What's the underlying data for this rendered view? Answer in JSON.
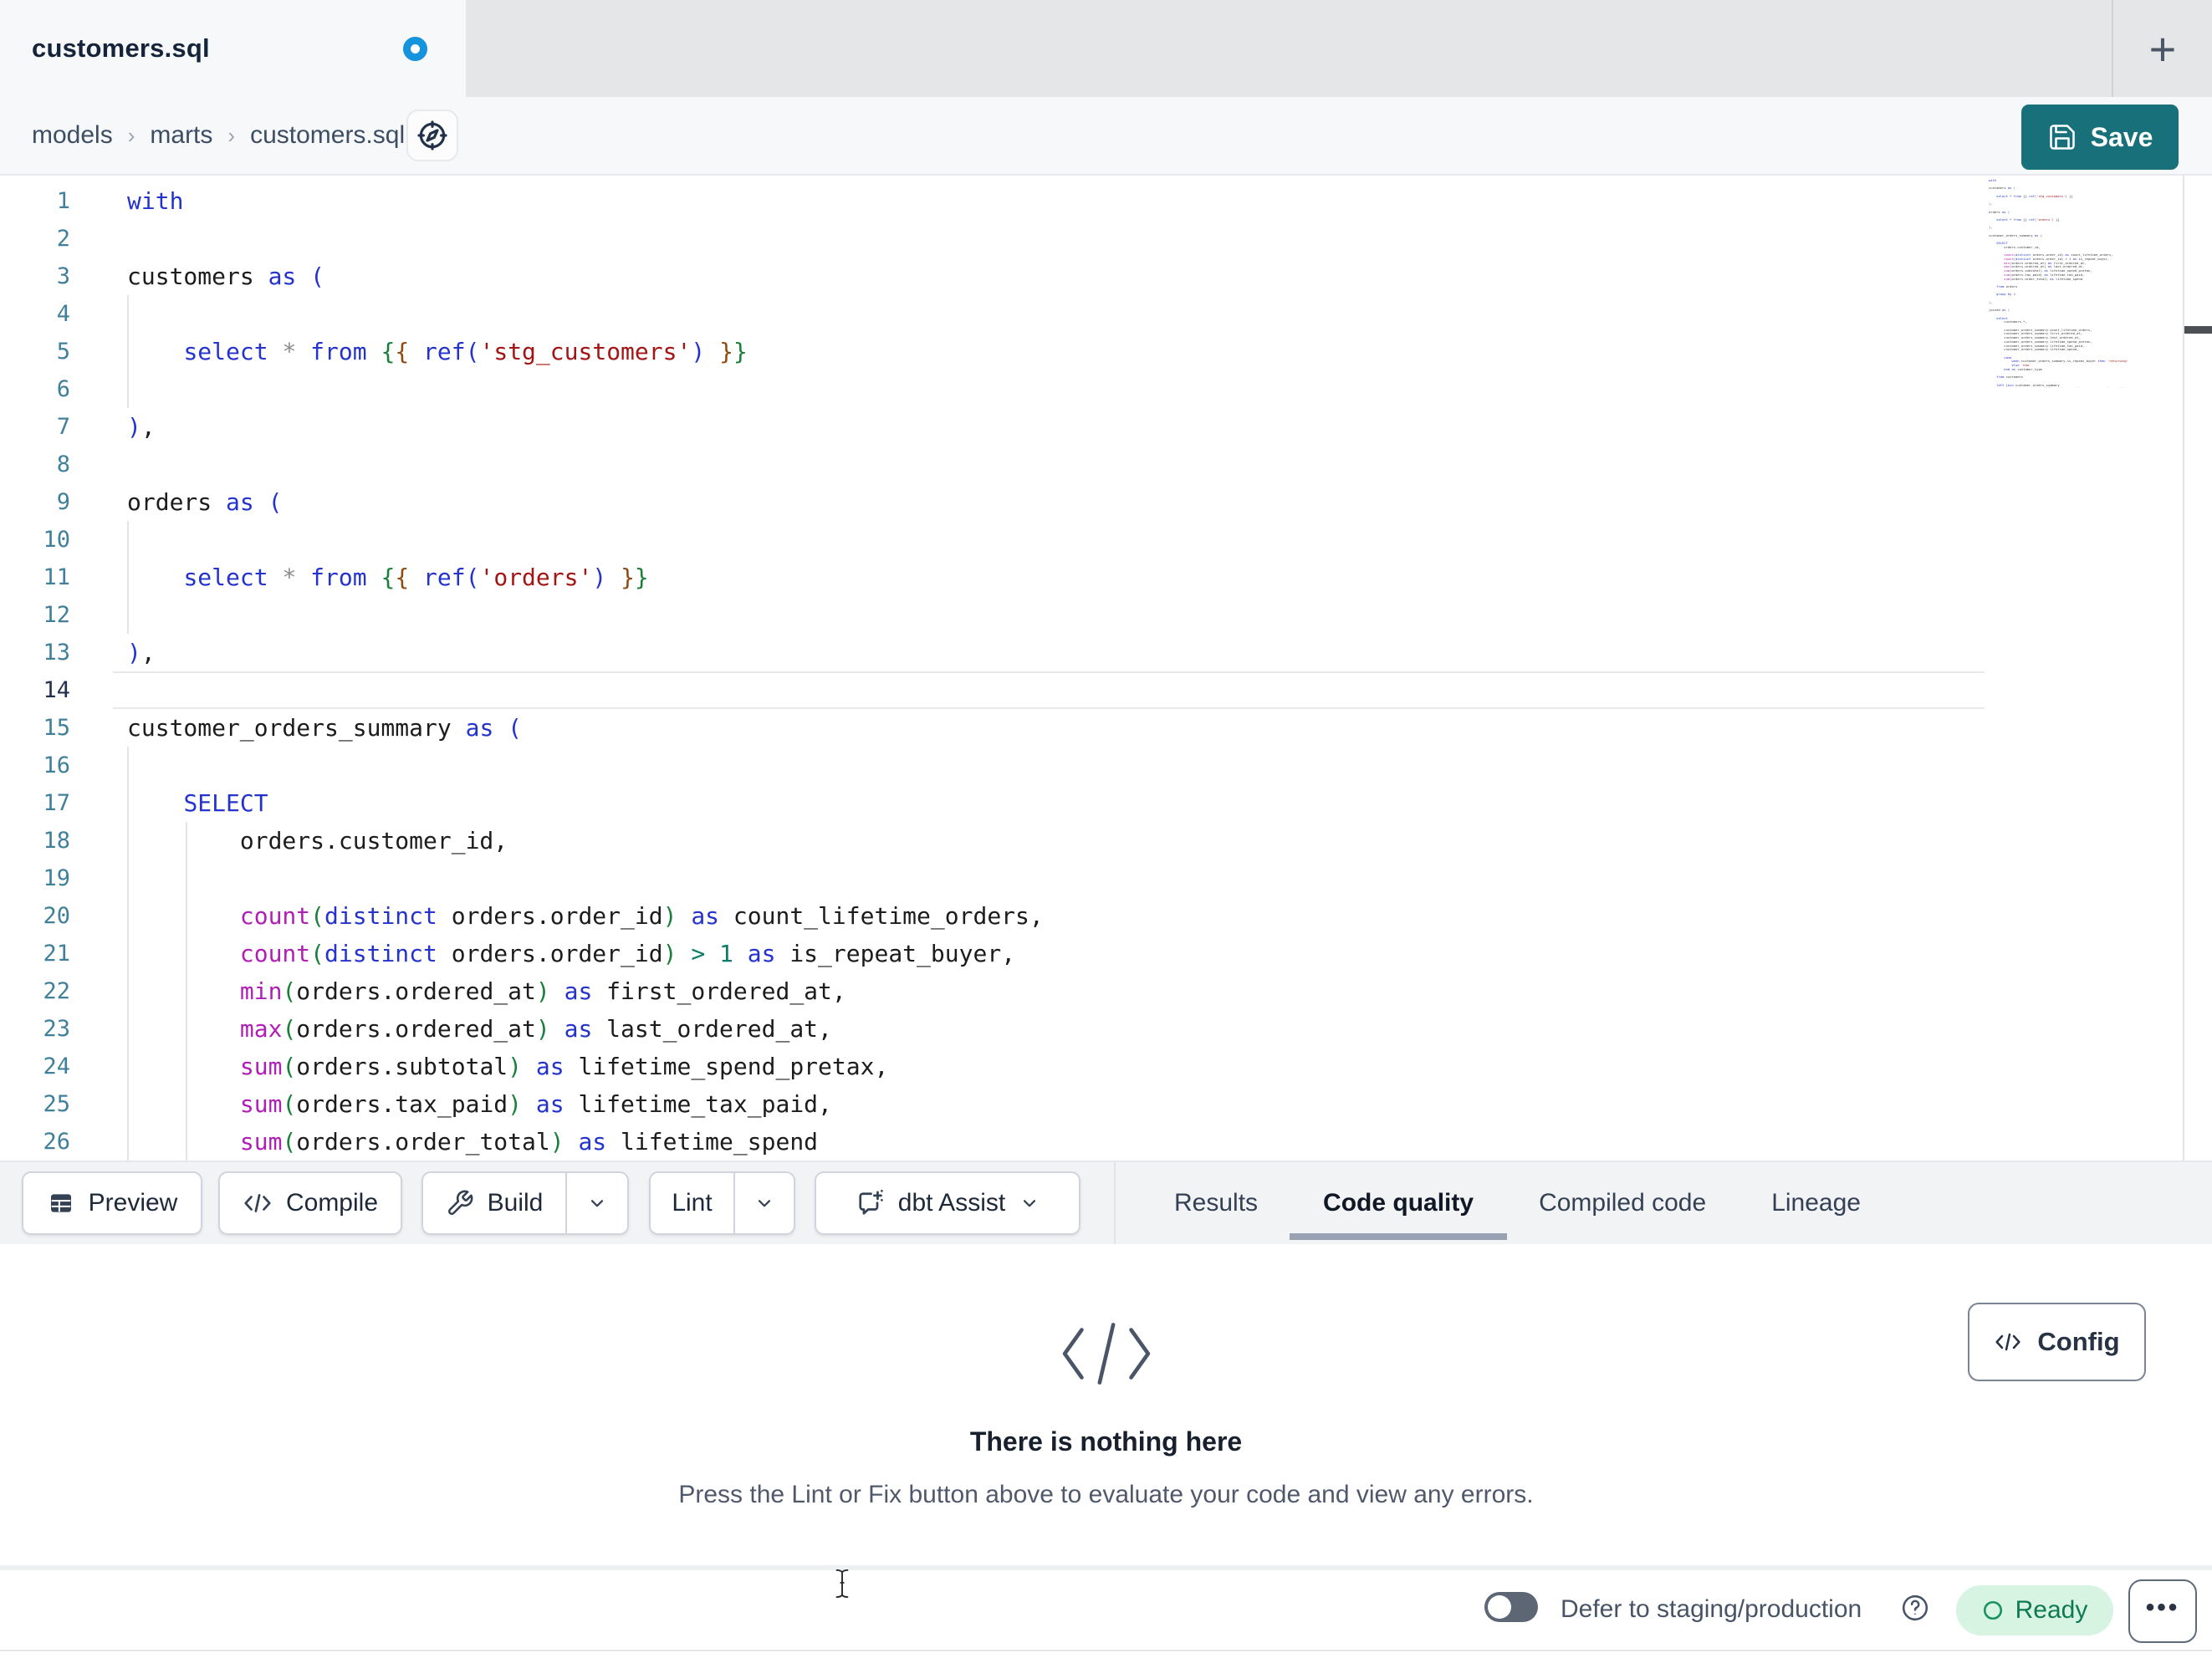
{
  "tab_bar": {
    "active_tab": "customers.sql",
    "unsaved": true,
    "new_tab_glyph": "+"
  },
  "breadcrumb": {
    "items": [
      "models",
      "marts",
      "customers.sql"
    ],
    "separator": "›",
    "icon": "compass-icon"
  },
  "save_button": {
    "label": "Save",
    "icon": "floppy-icon",
    "color": "#17707a"
  },
  "editor": {
    "active_line": 14,
    "lines": [
      {
        "n": 1,
        "t": [
          [
            "with",
            "k"
          ]
        ]
      },
      {
        "n": 2,
        "t": []
      },
      {
        "n": 3,
        "t": [
          [
            "customers",
            "d"
          ],
          [
            " ",
            "d"
          ],
          [
            "as",
            "k"
          ],
          [
            " ",
            "d"
          ],
          [
            "(",
            "b"
          ]
        ]
      },
      {
        "n": 4,
        "t": []
      },
      {
        "n": 5,
        "t": [
          [
            "    ",
            "d"
          ],
          [
            "select",
            "k"
          ],
          [
            " ",
            "d"
          ],
          [
            "*",
            "x"
          ],
          [
            " ",
            "d"
          ],
          [
            "from",
            "k"
          ],
          [
            " ",
            "d"
          ],
          [
            "{",
            "o"
          ],
          [
            "{",
            "j"
          ],
          [
            " ",
            "d"
          ],
          [
            "ref",
            "k"
          ],
          [
            "(",
            "b"
          ],
          [
            "'stg_customers'",
            "s"
          ],
          [
            ")",
            "b"
          ],
          [
            " ",
            "d"
          ],
          [
            "}",
            "j"
          ],
          [
            "}",
            "o"
          ]
        ]
      },
      {
        "n": 6,
        "t": []
      },
      {
        "n": 7,
        "t": [
          [
            ")",
            "b"
          ],
          [
            ",",
            "d"
          ]
        ]
      },
      {
        "n": 8,
        "t": []
      },
      {
        "n": 9,
        "t": [
          [
            "orders",
            "d"
          ],
          [
            " ",
            "d"
          ],
          [
            "as",
            "k"
          ],
          [
            " ",
            "d"
          ],
          [
            "(",
            "b"
          ]
        ]
      },
      {
        "n": 10,
        "t": []
      },
      {
        "n": 11,
        "t": [
          [
            "    ",
            "d"
          ],
          [
            "select",
            "k"
          ],
          [
            " ",
            "d"
          ],
          [
            "*",
            "x"
          ],
          [
            " ",
            "d"
          ],
          [
            "from",
            "k"
          ],
          [
            " ",
            "d"
          ],
          [
            "{",
            "o"
          ],
          [
            "{",
            "j"
          ],
          [
            " ",
            "d"
          ],
          [
            "ref",
            "k"
          ],
          [
            "(",
            "b"
          ],
          [
            "'orders'",
            "s"
          ],
          [
            ")",
            "b"
          ],
          [
            " ",
            "d"
          ],
          [
            "}",
            "j"
          ],
          [
            "}",
            "o"
          ]
        ]
      },
      {
        "n": 12,
        "t": []
      },
      {
        "n": 13,
        "t": [
          [
            ")",
            "b"
          ],
          [
            ",",
            "d"
          ]
        ]
      },
      {
        "n": 14,
        "t": []
      },
      {
        "n": 15,
        "t": [
          [
            "customer_orders_summary",
            "d"
          ],
          [
            " ",
            "d"
          ],
          [
            "as",
            "k"
          ],
          [
            " ",
            "d"
          ],
          [
            "(",
            "b"
          ]
        ]
      },
      {
        "n": 16,
        "t": []
      },
      {
        "n": 17,
        "t": [
          [
            "    ",
            "d"
          ],
          [
            "SELECT",
            "k"
          ]
        ]
      },
      {
        "n": 18,
        "t": [
          [
            "        orders.customer_id,",
            "d"
          ]
        ]
      },
      {
        "n": 19,
        "t": []
      },
      {
        "n": 20,
        "t": [
          [
            "        ",
            "d"
          ],
          [
            "count",
            "f"
          ],
          [
            "(",
            "g"
          ],
          [
            "distinct",
            "k"
          ],
          [
            " orders.order_id",
            "d"
          ],
          [
            ")",
            "g"
          ],
          [
            " ",
            "d"
          ],
          [
            "as",
            "k"
          ],
          [
            " count_lifetime_orders,",
            "d"
          ]
        ]
      },
      {
        "n": 21,
        "t": [
          [
            "        ",
            "d"
          ],
          [
            "count",
            "f"
          ],
          [
            "(",
            "g"
          ],
          [
            "distinct",
            "k"
          ],
          [
            " orders.order_id",
            "d"
          ],
          [
            ")",
            "g"
          ],
          [
            " ",
            "d"
          ],
          [
            ">",
            "n"
          ],
          [
            " ",
            "d"
          ],
          [
            "1",
            "n"
          ],
          [
            " ",
            "d"
          ],
          [
            "as",
            "k"
          ],
          [
            " is_repeat_buyer,",
            "d"
          ]
        ]
      },
      {
        "n": 22,
        "t": [
          [
            "        ",
            "d"
          ],
          [
            "min",
            "f"
          ],
          [
            "(",
            "g"
          ],
          [
            "orders.ordered_at",
            "d"
          ],
          [
            ")",
            "g"
          ],
          [
            " ",
            "d"
          ],
          [
            "as",
            "k"
          ],
          [
            " first_ordered_at,",
            "d"
          ]
        ]
      },
      {
        "n": 23,
        "t": [
          [
            "        ",
            "d"
          ],
          [
            "max",
            "f"
          ],
          [
            "(",
            "g"
          ],
          [
            "orders.ordered_at",
            "d"
          ],
          [
            ")",
            "g"
          ],
          [
            " ",
            "d"
          ],
          [
            "as",
            "k"
          ],
          [
            " last_ordered_at,",
            "d"
          ]
        ]
      },
      {
        "n": 24,
        "t": [
          [
            "        ",
            "d"
          ],
          [
            "sum",
            "f"
          ],
          [
            "(",
            "g"
          ],
          [
            "orders.subtotal",
            "d"
          ],
          [
            ")",
            "g"
          ],
          [
            " ",
            "d"
          ],
          [
            "as",
            "k"
          ],
          [
            " lifetime_spend_pretax,",
            "d"
          ]
        ]
      },
      {
        "n": 25,
        "t": [
          [
            "        ",
            "d"
          ],
          [
            "sum",
            "f"
          ],
          [
            "(",
            "g"
          ],
          [
            "orders.tax_paid",
            "d"
          ],
          [
            ")",
            "g"
          ],
          [
            " ",
            "d"
          ],
          [
            "as",
            "k"
          ],
          [
            " lifetime_tax_paid,",
            "d"
          ]
        ]
      },
      {
        "n": 26,
        "t": [
          [
            "        ",
            "d"
          ],
          [
            "sum",
            "f"
          ],
          [
            "(",
            "g"
          ],
          [
            "orders.order_total",
            "d"
          ],
          [
            ")",
            "g"
          ],
          [
            " ",
            "d"
          ],
          [
            "as",
            "k"
          ],
          [
            " lifetime_spend",
            "d"
          ]
        ]
      }
    ]
  },
  "minimap": {
    "lines": [
      "with",
      "",
      "customers as (",
      "",
      "    select * from {{ ref('stg_customers') }}",
      "",
      "),",
      "",
      "orders as (",
      "",
      "    select * from {{ ref('orders') }}",
      "",
      "),",
      "",
      "customer_orders_summary as (",
      "",
      "    SELECT",
      "        orders.customer_id,",
      "",
      "        count(distinct orders.order_id) as count_lifetime_orders,",
      "        count(distinct orders.order_id) > 1 as is_repeat_buyer,",
      "        min(orders.ordered_at) as first_ordered_at,",
      "        max(orders.ordered_at) as last_ordered_at,",
      "        sum(orders.subtotal) as lifetime_spend_pretax,",
      "        sum(orders.tax_paid) as lifetime_tax_paid,",
      "        sum(orders.order_total) as lifetime_spend",
      "",
      "    from orders",
      "",
      "    group by 1",
      "",
      "),",
      "",
      "joined as (",
      "",
      "    select",
      "        customers.*,",
      "",
      "        customer_orders_summary.count_lifetime_orders,",
      "        customer_orders_summary.first_ordered_at,",
      "        customer_orders_summary.last_ordered_at,",
      "        customer_orders_summary.lifetime_spend_pretax,",
      "        customer_orders_summary.lifetime_tax_paid,",
      "        customer_orders_summary.lifetime_spend,",
      "",
      "        case",
      "            when customer_orders_summary.is_repeat_buyer then 'returning'",
      "            else 'new'",
      "        end as customer_type",
      "",
      "    from customers",
      "",
      "    left join customer_orders_summary",
      "        on customers.customer_id = customer_orders_summary.customer_id",
      "",
      ")",
      "",
      "select * from joined"
    ]
  },
  "toolbar": {
    "preview_label": "Preview",
    "compile_label": "Compile",
    "build_label": "Build",
    "lint_label": "Lint",
    "assist_label": "dbt Assist"
  },
  "panel_tabs": [
    {
      "label": "Results",
      "active": false
    },
    {
      "label": "Code quality",
      "active": true
    },
    {
      "label": "Compiled code",
      "active": false
    },
    {
      "label": "Lineage",
      "active": false
    }
  ],
  "results_panel": {
    "empty_icon": "code-slash-icon",
    "empty_title": "There is nothing here",
    "empty_subtitle": "Press the Lint or Fix button above to evaluate your code and view any errors.",
    "config_label": "Config"
  },
  "status_bar": {
    "toggle_on": false,
    "defer_label": "Defer to staging/production",
    "help_icon": "question-circle-icon",
    "ready_label": "Ready",
    "more_glyph": "•••",
    "ready_colors": {
      "bg": "#d7f4e3",
      "text": "#0f7a52"
    }
  }
}
